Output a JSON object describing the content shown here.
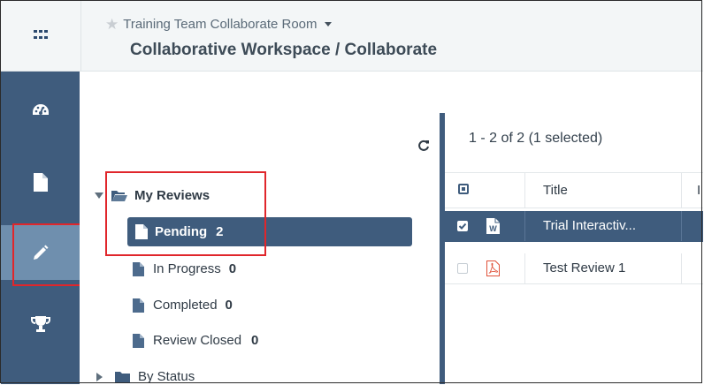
{
  "header": {
    "room_name": "Training Team Collaborate Room",
    "breadcrumb": "Collaborative Workspace / Collaborate"
  },
  "sidebar": {
    "items": [
      {
        "name": "dashboard",
        "icon": "gauge-icon"
      },
      {
        "name": "documents",
        "icon": "document-icon"
      },
      {
        "name": "reviews",
        "icon": "pencil-icon",
        "active": true
      },
      {
        "name": "achievements",
        "icon": "trophy-icon"
      }
    ]
  },
  "tree": {
    "my_reviews_label": "My Reviews",
    "items": [
      {
        "label": "Pending",
        "count": "2",
        "selected": true
      },
      {
        "label": "In Progress",
        "count": "0"
      },
      {
        "label": "Completed",
        "count": "0"
      },
      {
        "label": "Review Closed",
        "count": "0"
      }
    ],
    "by_status_label": "By Status"
  },
  "grid": {
    "pager": "1 - 2 of 2 (1 selected)",
    "columns": {
      "title": "Title",
      "next_partial": "I"
    },
    "rows": [
      {
        "title": "Trial Interactiv...",
        "file_type": "word-icon",
        "checked": true
      },
      {
        "title": "Test Review 1",
        "file_type": "pdf-icon",
        "checked": false
      }
    ]
  },
  "colors": {
    "sidebar_bg": "#3f5c7d",
    "sidebar_active": "#6f8fae",
    "highlight_red": "#e0262b",
    "pdf_red": "#e0523a",
    "word_blue": "#2b579a"
  }
}
